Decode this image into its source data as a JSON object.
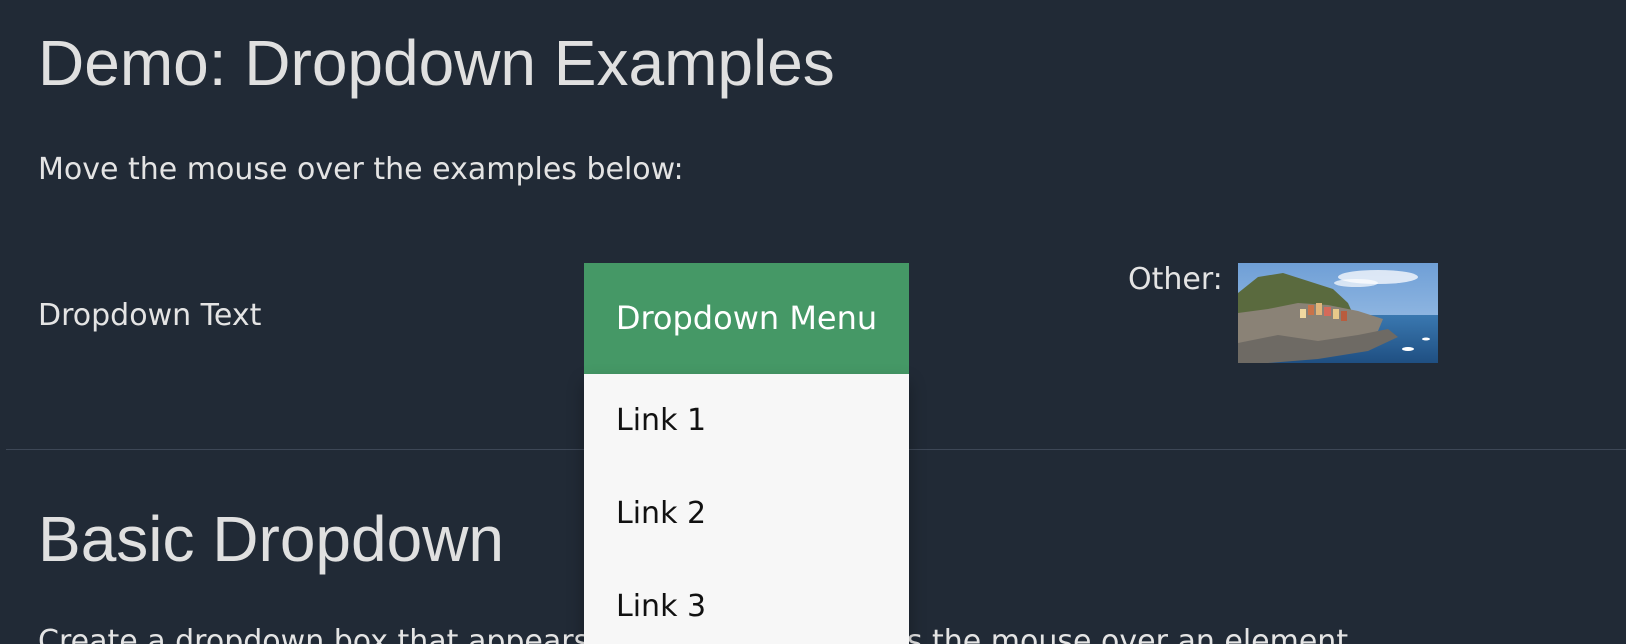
{
  "page": {
    "title": "Demo: Dropdown Examples",
    "intro": "Move the mouse over the examples below:"
  },
  "examples": {
    "dropdown_text": "Dropdown Text",
    "dropdown_menu": {
      "button_label": "Dropdown Menu",
      "links": [
        "Link 1",
        "Link 2",
        "Link 3"
      ]
    },
    "other_label": "Other:"
  },
  "basic": {
    "heading": "Basic Dropdown",
    "description": "Create a dropdown box that appears when the user moves the mouse over an element."
  },
  "colors": {
    "background": "#212a36",
    "accent": "#459866",
    "menu_bg": "#f7f7f7"
  }
}
